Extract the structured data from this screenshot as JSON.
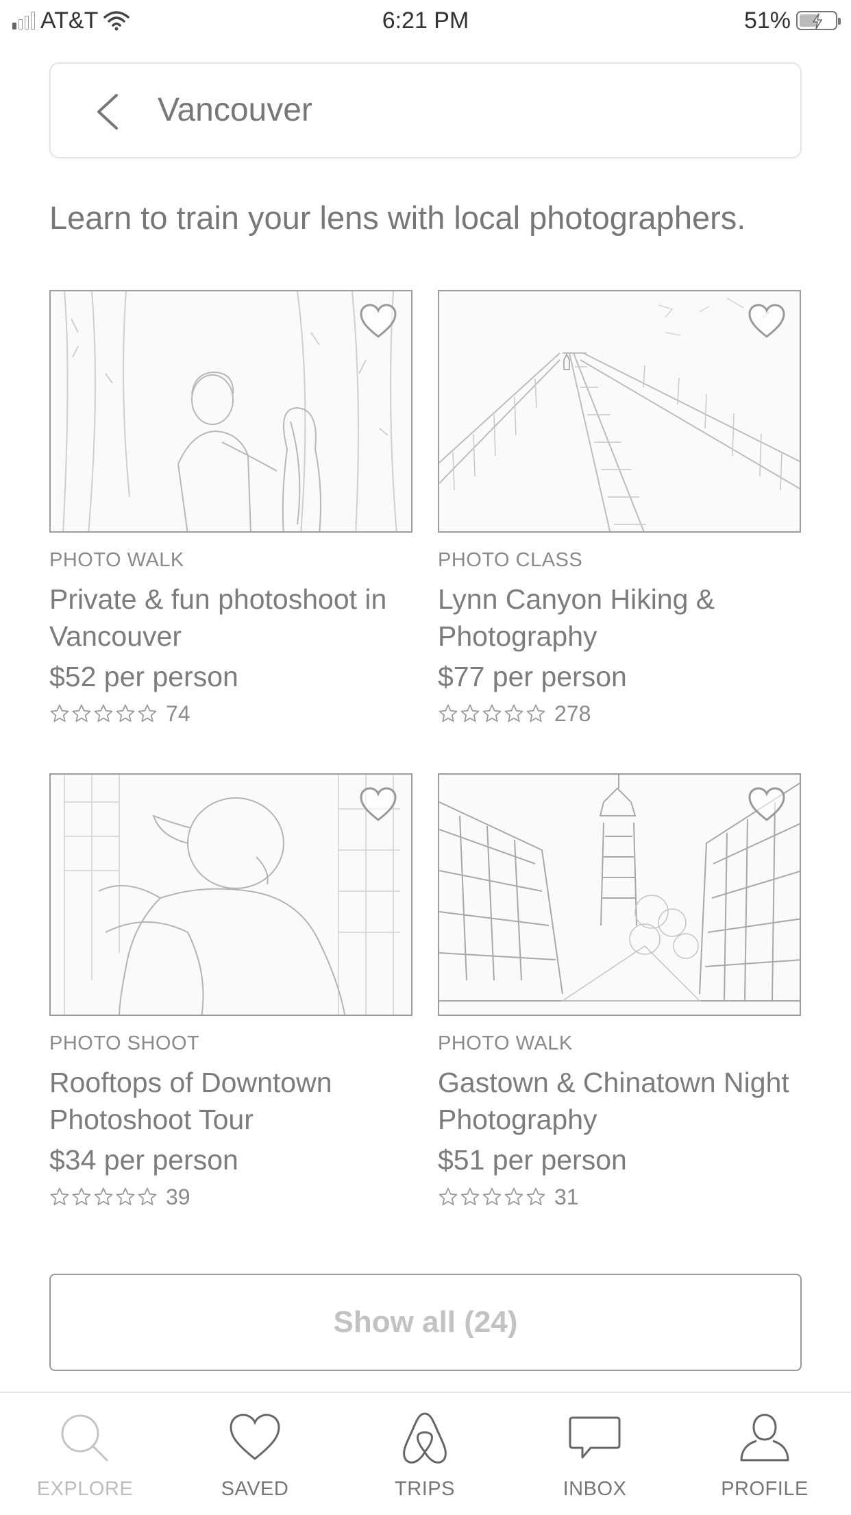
{
  "status_bar": {
    "carrier": "AT&T",
    "time": "6:21 PM",
    "battery_percent": "51%",
    "battery_level": 0.51,
    "signal_bars_on": 1,
    "icons": [
      "signal-icon",
      "wifi-icon",
      "battery-charging-icon"
    ]
  },
  "search": {
    "query": "Vancouver",
    "back_icon": "chevron-left-icon"
  },
  "headline": "Learn to train your lens with local photographers.",
  "experiences": [
    {
      "category": "PHOTO WALK",
      "title": "Private & fun photoshoot in Vancouver",
      "price": "$52 per person",
      "stars": 5,
      "reviews": "74",
      "image": "couple-in-forest-photo"
    },
    {
      "category": "PHOTO CLASS",
      "title": "Lynn Canyon Hiking & Photography",
      "price": "$77 per person",
      "stars": 5,
      "reviews": "278",
      "image": "suspension-bridge-photo"
    },
    {
      "category": "PHOTO SHOOT",
      "title": "Rooftops of Downtown Photoshoot Tour",
      "price": "$34 per person",
      "stars": 5,
      "reviews": "39",
      "image": "woman-on-rooftop-photo"
    },
    {
      "category": "PHOTO WALK",
      "title": "Gastown & Chinatown Night Photography",
      "price": "$51 per person",
      "stars": 5,
      "reviews": "31",
      "image": "gastown-street-photo"
    }
  ],
  "show_all": "Show all (24)",
  "tab_bar": {
    "active": "explore",
    "tabs": [
      {
        "id": "explore",
        "label": "EXPLORE",
        "icon": "search-icon"
      },
      {
        "id": "saved",
        "label": "SAVED",
        "icon": "heart-icon"
      },
      {
        "id": "trips",
        "label": "TRIPS",
        "icon": "airbnb-logo-icon"
      },
      {
        "id": "inbox",
        "label": "INBOX",
        "icon": "chat-bubble-icon"
      },
      {
        "id": "profile",
        "label": "PROFILE",
        "icon": "person-icon"
      }
    ]
  },
  "colors": {
    "text_primary": "#7c7c7c",
    "text_secondary": "#8a8a8a",
    "border": "#9c9c9c",
    "background": "#ffffff"
  }
}
